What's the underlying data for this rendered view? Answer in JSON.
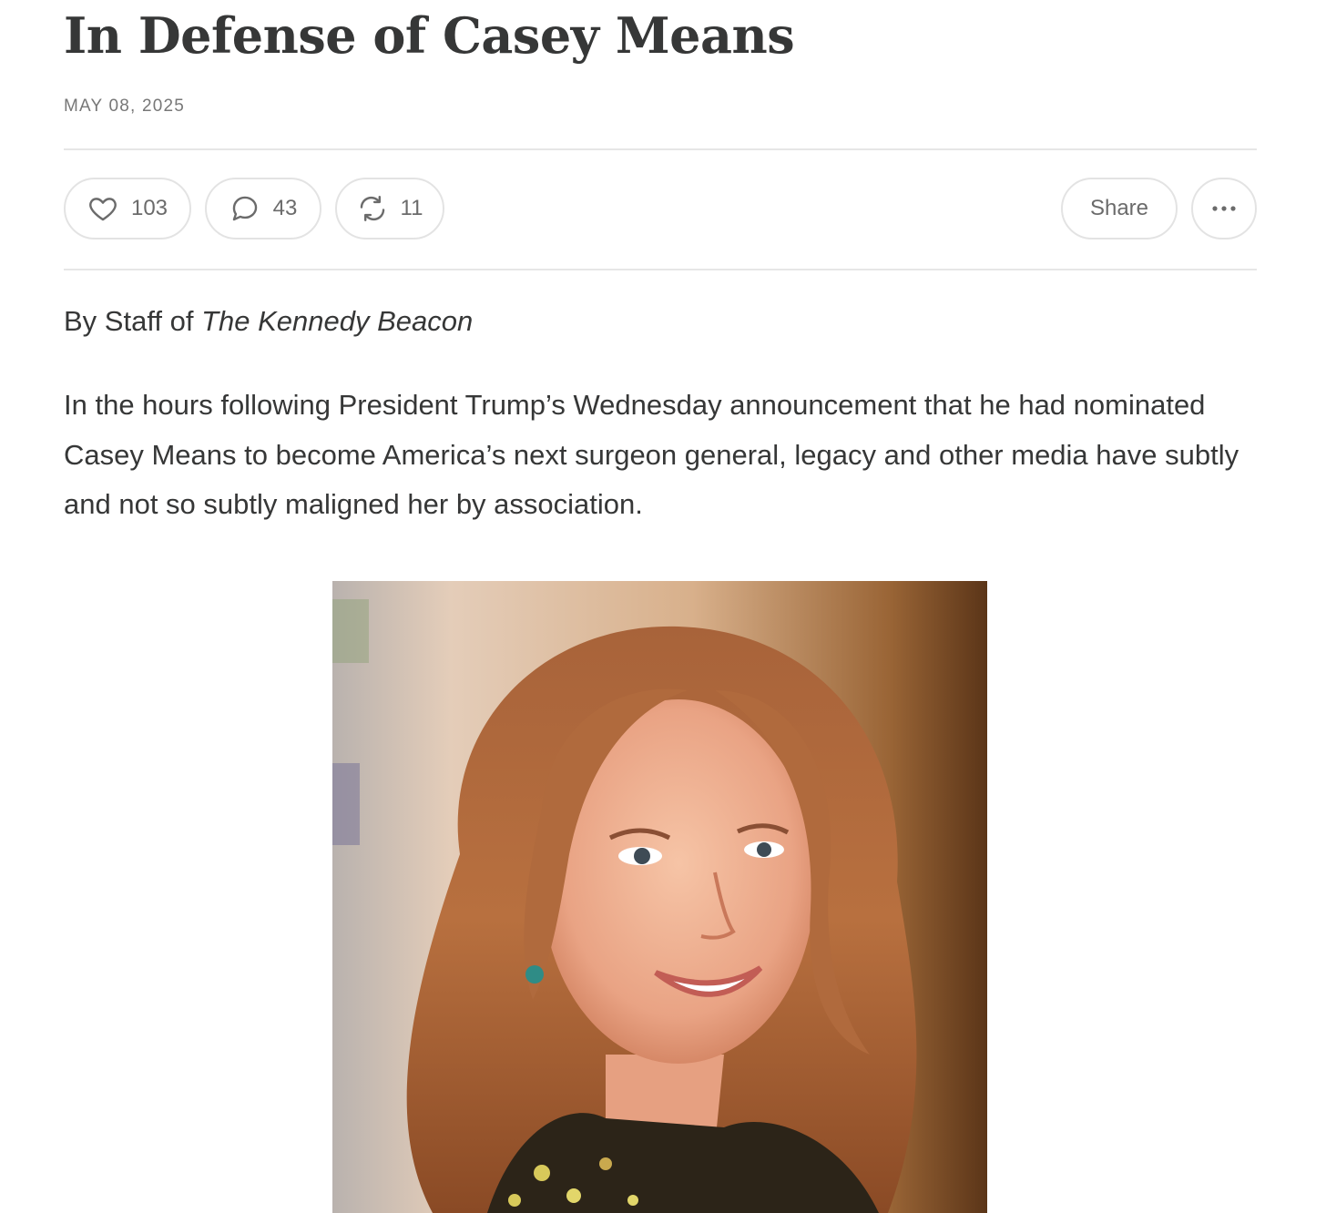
{
  "post": {
    "title": "In Defense of Casey Means",
    "date": "MAY 08, 2025",
    "byline_prefix": "By Staff of ",
    "byline_publication": "The Kennedy Beacon",
    "lead_paragraph": "In the hours following President Trump’s Wednesday announcement that he had nominated Casey Means to become America’s next surgeon general, legacy and other media have subtly and not so subtly maligned her by association."
  },
  "actions": {
    "like_count": "103",
    "comment_count": "43",
    "restack_count": "11",
    "share_label": "Share",
    "like_icon": "heart-icon",
    "comment_icon": "speech-bubble-icon",
    "restack_icon": "restack-arrows-icon",
    "more_icon": "ellipsis-icon"
  },
  "colors": {
    "text": "#363737",
    "muted": "#777777",
    "border": "#e3e3e3"
  }
}
